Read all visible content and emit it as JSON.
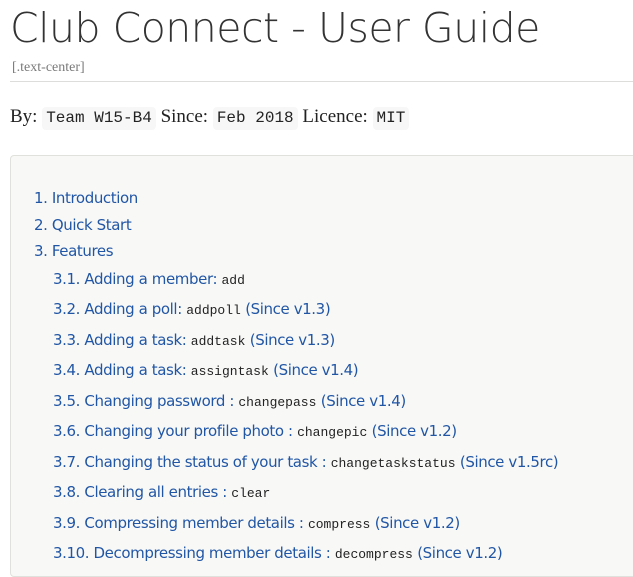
{
  "header": {
    "title": "Club Connect - User Guide",
    "role": "[.text-center]",
    "details": {
      "by_label": "By:",
      "by_value": "Team W15-B4",
      "since_label": "Since:",
      "since_value": "Feb 2018",
      "licence_label": "Licence:",
      "licence_value": "MIT"
    }
  },
  "toc": {
    "colors": {
      "link": "#2156a5",
      "background": "#f8f8f7"
    },
    "items": [
      {
        "label": "1. Introduction",
        "code": "",
        "suffix": ""
      },
      {
        "label": "2. Quick Start",
        "code": "",
        "suffix": ""
      },
      {
        "label": "3. Features",
        "code": "",
        "suffix": ""
      }
    ],
    "sub_items": [
      {
        "label": "3.1. Adding a member: ",
        "code": "add",
        "suffix": ""
      },
      {
        "label": "3.2. Adding a poll: ",
        "code": "addpoll",
        "suffix": " (Since v1.3)"
      },
      {
        "label": "3.3. Adding a task: ",
        "code": "addtask",
        "suffix": " (Since v1.3)"
      },
      {
        "label": "3.4. Adding a task: ",
        "code": "assigntask",
        "suffix": " (Since v1.4)"
      },
      {
        "label": "3.5. Changing password : ",
        "code": "changepass",
        "suffix": " (Since v1.4)"
      },
      {
        "label": "3.6. Changing your profile photo : ",
        "code": "changepic",
        "suffix": " (Since v1.2)"
      },
      {
        "label": "3.7. Changing the status of your task : ",
        "code": "changetaskstatus",
        "suffix": " (Since v1.5rc)"
      },
      {
        "label": "3.8. Clearing all entries : ",
        "code": "clear",
        "suffix": ""
      },
      {
        "label": "3.9. Compressing member details : ",
        "code": "compress",
        "suffix": " (Since v1.2)"
      },
      {
        "label": "3.10. Decompressing member details : ",
        "code": "decompress",
        "suffix": " (Since v1.2)"
      }
    ]
  }
}
